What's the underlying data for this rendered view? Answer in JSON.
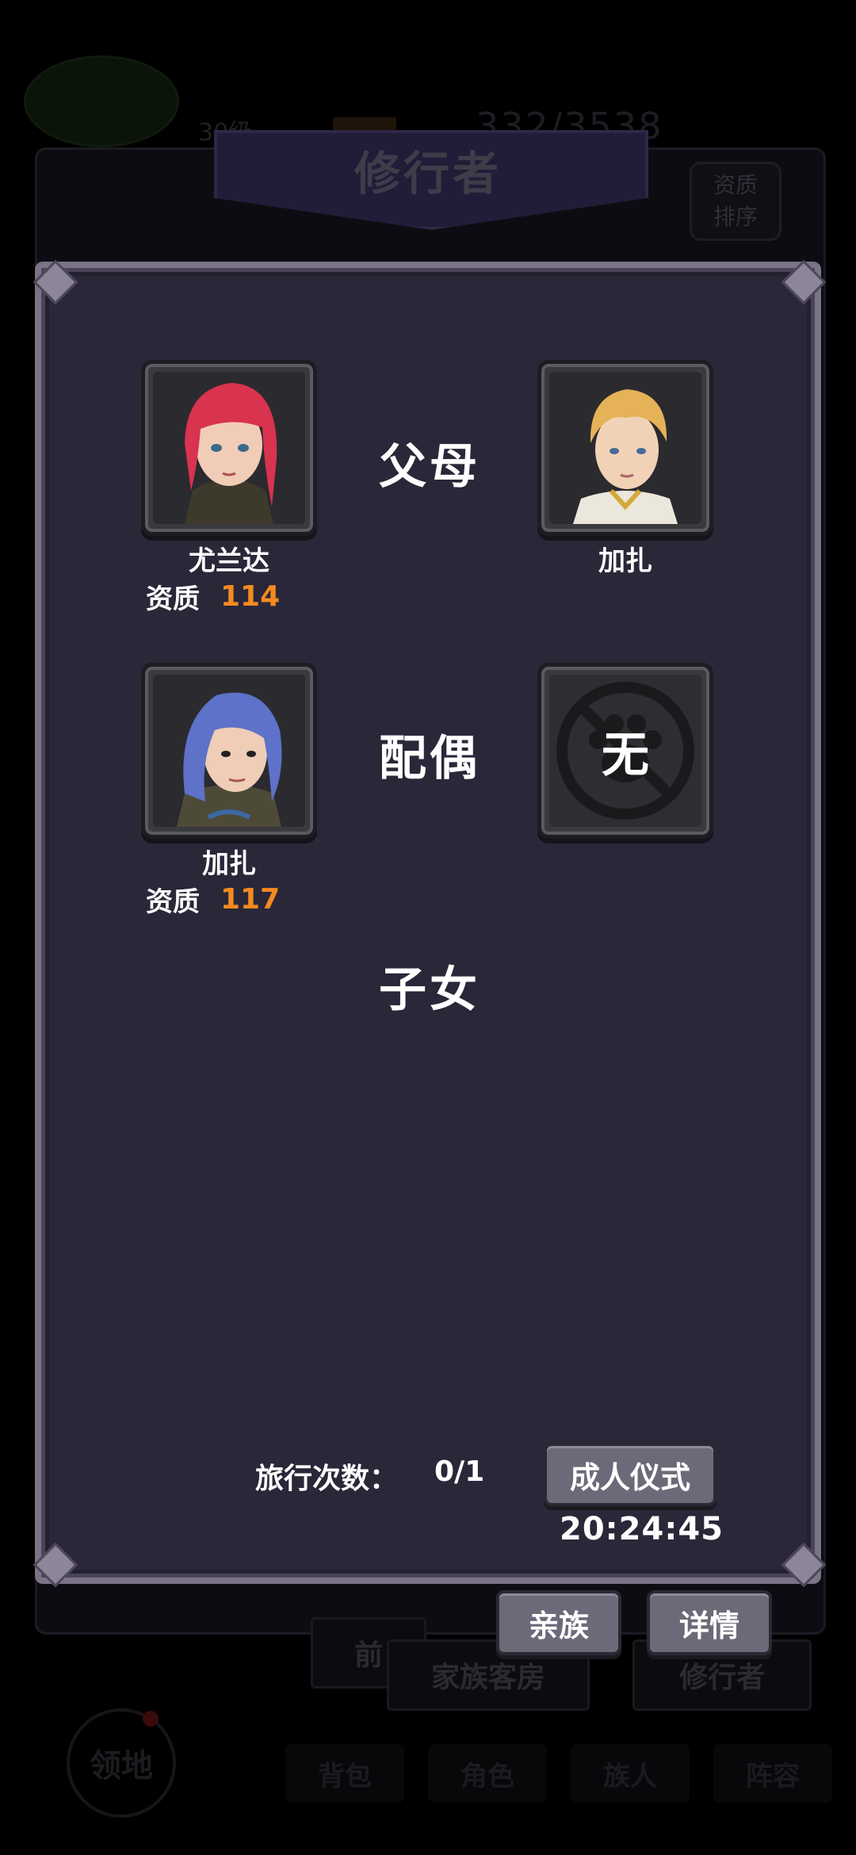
{
  "background": {
    "level_text": "30级",
    "count_text": "332/3538",
    "buttons": [
      "前",
      "家族客房",
      "修行者"
    ],
    "nav": [
      "背包",
      "角色",
      "族人",
      "阵容"
    ],
    "territory": "领地"
  },
  "header": {
    "title": "修行者",
    "sort_button": [
      "资质",
      "排序"
    ]
  },
  "family": {
    "parents_label": "父母",
    "spouse_label": "配偶",
    "children_label": "子女",
    "parents": [
      {
        "name": "尤兰达",
        "aptitude_label": "资质",
        "aptitude": "114",
        "hair": "#d8334f"
      },
      {
        "name": "加扎",
        "aptitude_label": "",
        "aptitude": "",
        "hair": "#e5b257"
      }
    ],
    "self": {
      "name": "加扎",
      "aptitude_label": "资质",
      "aptitude": "117",
      "hair": "#5d72c8"
    },
    "spouse": {
      "empty_text": "无"
    }
  },
  "footer": {
    "travel_label": "旅行次数：",
    "travel_value": "0/1",
    "ceremony_button": "成人仪式",
    "timer": "20:24:45",
    "clan_button": "亲族",
    "detail_button": "详情"
  },
  "colors": {
    "aptitude": "#f58a1f",
    "panel": "#2a2739",
    "border": "#7b7386"
  }
}
